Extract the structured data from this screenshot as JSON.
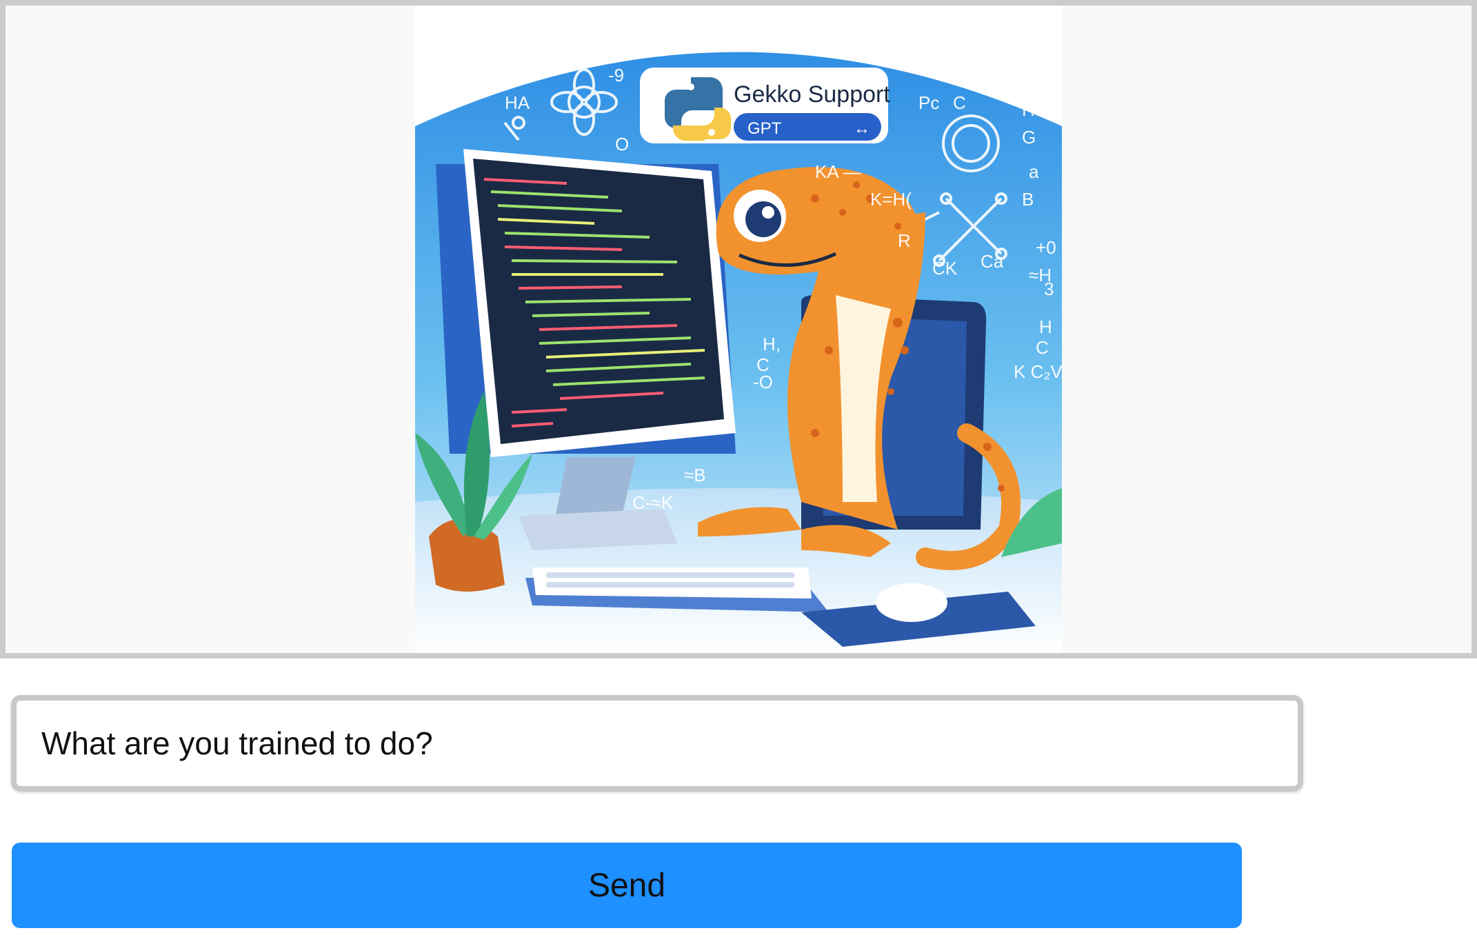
{
  "hero": {
    "badge_title": "Gekko Support",
    "badge_tag": "GPT",
    "badge_tag_arrows": "↔",
    "science_scribbles": [
      "HA",
      "KA —",
      "K=H(",
      "R",
      "CK",
      "Ca",
      "H3",
      "G",
      "a",
      "B",
      "+0",
      "≈H",
      "3",
      "H",
      "C",
      "K C₂V",
      "H,",
      "C",
      "-O",
      "≈B",
      "C-≈K",
      "-9",
      "O",
      "Pc",
      "C"
    ]
  },
  "prompt": {
    "value": "What are you trained to do?"
  },
  "send": {
    "label": "Send"
  },
  "colors": {
    "frame_border": "#cccccc",
    "frame_bg": "#f9f9f9",
    "send_bg": "#1e90ff",
    "sky_blue": "#4aa8ec",
    "gecko_orange": "#f2922e",
    "monitor_dark": "#1a2a44"
  }
}
